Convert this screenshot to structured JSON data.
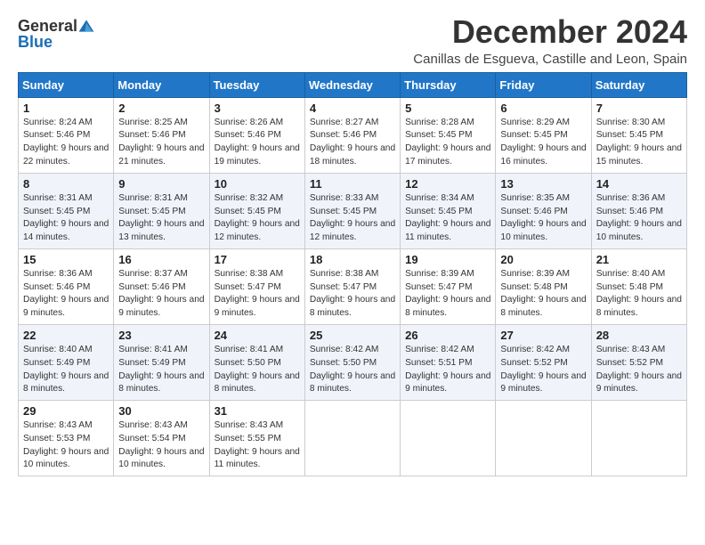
{
  "logo": {
    "general": "General",
    "blue": "Blue"
  },
  "title": "December 2024",
  "subtitle": "Canillas de Esgueva, Castille and Leon, Spain",
  "days_header": [
    "Sunday",
    "Monday",
    "Tuesday",
    "Wednesday",
    "Thursday",
    "Friday",
    "Saturday"
  ],
  "weeks": [
    [
      {
        "day": "1",
        "sunrise": "Sunrise: 8:24 AM",
        "sunset": "Sunset: 5:46 PM",
        "daylight": "Daylight: 9 hours and 22 minutes."
      },
      {
        "day": "2",
        "sunrise": "Sunrise: 8:25 AM",
        "sunset": "Sunset: 5:46 PM",
        "daylight": "Daylight: 9 hours and 21 minutes."
      },
      {
        "day": "3",
        "sunrise": "Sunrise: 8:26 AM",
        "sunset": "Sunset: 5:46 PM",
        "daylight": "Daylight: 9 hours and 19 minutes."
      },
      {
        "day": "4",
        "sunrise": "Sunrise: 8:27 AM",
        "sunset": "Sunset: 5:46 PM",
        "daylight": "Daylight: 9 hours and 18 minutes."
      },
      {
        "day": "5",
        "sunrise": "Sunrise: 8:28 AM",
        "sunset": "Sunset: 5:45 PM",
        "daylight": "Daylight: 9 hours and 17 minutes."
      },
      {
        "day": "6",
        "sunrise": "Sunrise: 8:29 AM",
        "sunset": "Sunset: 5:45 PM",
        "daylight": "Daylight: 9 hours and 16 minutes."
      },
      {
        "day": "7",
        "sunrise": "Sunrise: 8:30 AM",
        "sunset": "Sunset: 5:45 PM",
        "daylight": "Daylight: 9 hours and 15 minutes."
      }
    ],
    [
      {
        "day": "8",
        "sunrise": "Sunrise: 8:31 AM",
        "sunset": "Sunset: 5:45 PM",
        "daylight": "Daylight: 9 hours and 14 minutes."
      },
      {
        "day": "9",
        "sunrise": "Sunrise: 8:31 AM",
        "sunset": "Sunset: 5:45 PM",
        "daylight": "Daylight: 9 hours and 13 minutes."
      },
      {
        "day": "10",
        "sunrise": "Sunrise: 8:32 AM",
        "sunset": "Sunset: 5:45 PM",
        "daylight": "Daylight: 9 hours and 12 minutes."
      },
      {
        "day": "11",
        "sunrise": "Sunrise: 8:33 AM",
        "sunset": "Sunset: 5:45 PM",
        "daylight": "Daylight: 9 hours and 12 minutes."
      },
      {
        "day": "12",
        "sunrise": "Sunrise: 8:34 AM",
        "sunset": "Sunset: 5:45 PM",
        "daylight": "Daylight: 9 hours and 11 minutes."
      },
      {
        "day": "13",
        "sunrise": "Sunrise: 8:35 AM",
        "sunset": "Sunset: 5:46 PM",
        "daylight": "Daylight: 9 hours and 10 minutes."
      },
      {
        "day": "14",
        "sunrise": "Sunrise: 8:36 AM",
        "sunset": "Sunset: 5:46 PM",
        "daylight": "Daylight: 9 hours and 10 minutes."
      }
    ],
    [
      {
        "day": "15",
        "sunrise": "Sunrise: 8:36 AM",
        "sunset": "Sunset: 5:46 PM",
        "daylight": "Daylight: 9 hours and 9 minutes."
      },
      {
        "day": "16",
        "sunrise": "Sunrise: 8:37 AM",
        "sunset": "Sunset: 5:46 PM",
        "daylight": "Daylight: 9 hours and 9 minutes."
      },
      {
        "day": "17",
        "sunrise": "Sunrise: 8:38 AM",
        "sunset": "Sunset: 5:47 PM",
        "daylight": "Daylight: 9 hours and 9 minutes."
      },
      {
        "day": "18",
        "sunrise": "Sunrise: 8:38 AM",
        "sunset": "Sunset: 5:47 PM",
        "daylight": "Daylight: 9 hours and 8 minutes."
      },
      {
        "day": "19",
        "sunrise": "Sunrise: 8:39 AM",
        "sunset": "Sunset: 5:47 PM",
        "daylight": "Daylight: 9 hours and 8 minutes."
      },
      {
        "day": "20",
        "sunrise": "Sunrise: 8:39 AM",
        "sunset": "Sunset: 5:48 PM",
        "daylight": "Daylight: 9 hours and 8 minutes."
      },
      {
        "day": "21",
        "sunrise": "Sunrise: 8:40 AM",
        "sunset": "Sunset: 5:48 PM",
        "daylight": "Daylight: 9 hours and 8 minutes."
      }
    ],
    [
      {
        "day": "22",
        "sunrise": "Sunrise: 8:40 AM",
        "sunset": "Sunset: 5:49 PM",
        "daylight": "Daylight: 9 hours and 8 minutes."
      },
      {
        "day": "23",
        "sunrise": "Sunrise: 8:41 AM",
        "sunset": "Sunset: 5:49 PM",
        "daylight": "Daylight: 9 hours and 8 minutes."
      },
      {
        "day": "24",
        "sunrise": "Sunrise: 8:41 AM",
        "sunset": "Sunset: 5:50 PM",
        "daylight": "Daylight: 9 hours and 8 minutes."
      },
      {
        "day": "25",
        "sunrise": "Sunrise: 8:42 AM",
        "sunset": "Sunset: 5:50 PM",
        "daylight": "Daylight: 9 hours and 8 minutes."
      },
      {
        "day": "26",
        "sunrise": "Sunrise: 8:42 AM",
        "sunset": "Sunset: 5:51 PM",
        "daylight": "Daylight: 9 hours and 9 minutes."
      },
      {
        "day": "27",
        "sunrise": "Sunrise: 8:42 AM",
        "sunset": "Sunset: 5:52 PM",
        "daylight": "Daylight: 9 hours and 9 minutes."
      },
      {
        "day": "28",
        "sunrise": "Sunrise: 8:43 AM",
        "sunset": "Sunset: 5:52 PM",
        "daylight": "Daylight: 9 hours and 9 minutes."
      }
    ],
    [
      {
        "day": "29",
        "sunrise": "Sunrise: 8:43 AM",
        "sunset": "Sunset: 5:53 PM",
        "daylight": "Daylight: 9 hours and 10 minutes."
      },
      {
        "day": "30",
        "sunrise": "Sunrise: 8:43 AM",
        "sunset": "Sunset: 5:54 PM",
        "daylight": "Daylight: 9 hours and 10 minutes."
      },
      {
        "day": "31",
        "sunrise": "Sunrise: 8:43 AM",
        "sunset": "Sunset: 5:55 PM",
        "daylight": "Daylight: 9 hours and 11 minutes."
      },
      null,
      null,
      null,
      null
    ]
  ]
}
